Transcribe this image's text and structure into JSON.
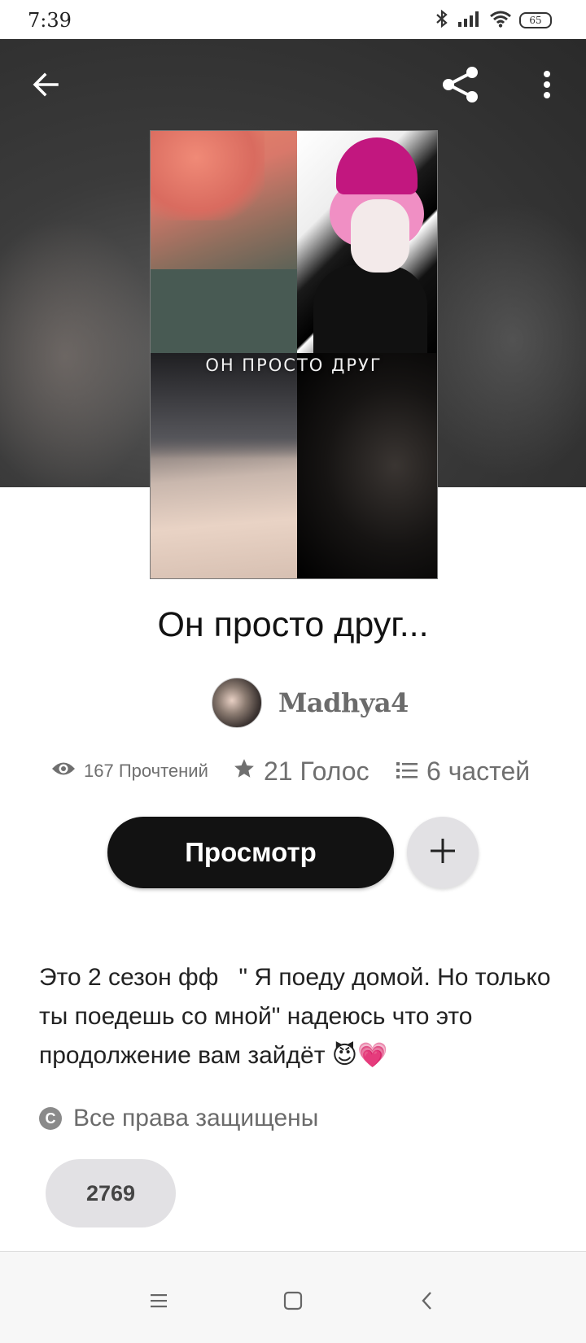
{
  "status_bar": {
    "time": "7:39",
    "battery": "65",
    "icons": [
      "bluetooth-icon",
      "signal-icon",
      "wifi-icon",
      "battery-icon"
    ]
  },
  "header": {
    "icons": [
      "back-arrow-icon",
      "share-icon",
      "more-vertical-icon"
    ]
  },
  "cover": {
    "title_text": "ОН ПРОСТО ДРУГ"
  },
  "story": {
    "title": "Он просто друг...",
    "author": "Madhya4",
    "reads_label": "167 Прочтений",
    "votes_label": "21 Голос",
    "parts_label": "6 частей",
    "read_button_label": "Просмотр",
    "description": "Это 2 сезон фф   \" Я поеду домой. Но только ты поедешь со мной\" надеюсь что это  продолжение вам зайдёт 😈💗",
    "copyright_label": "Все права защищены",
    "tag_label": "2769"
  },
  "colors": {
    "primary_button": "#121212",
    "secondary_button": "#e2e1e4",
    "muted_text": "#6f6f6f"
  },
  "nav_bar": {
    "icons": [
      "menu-icon",
      "home-square-icon",
      "back-chevron-icon"
    ]
  }
}
